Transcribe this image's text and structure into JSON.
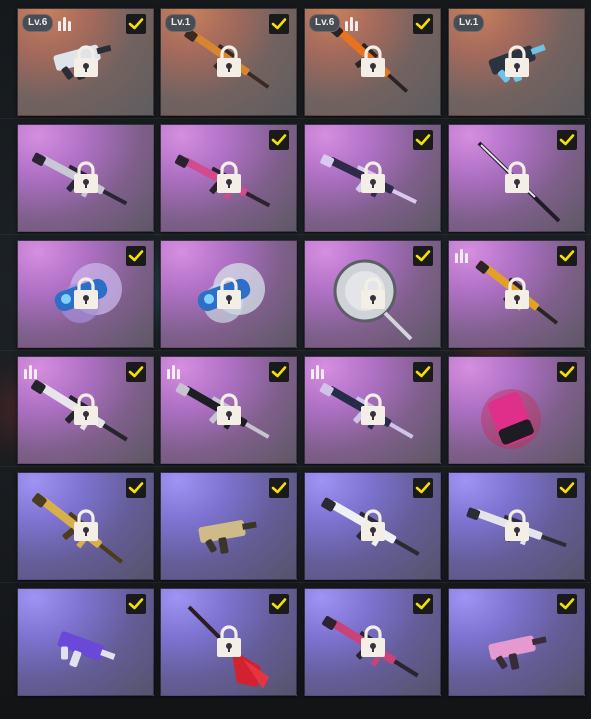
{
  "colors": {
    "check_mark": "#f5e100",
    "check_bg": "#1a1a1d",
    "badge_bg": "#4a4c53",
    "lock": "#f4efe6"
  },
  "items": [
    {
      "rarity": "orange",
      "level": "Lv.6",
      "ammo": true,
      "checked": true,
      "locked": true,
      "icon": "smg-white-icon"
    },
    {
      "rarity": "orange",
      "level": "Lv.1",
      "ammo": false,
      "checked": true,
      "locked": true,
      "icon": "rifle-orange-icon"
    },
    {
      "rarity": "orange",
      "level": "Lv.6",
      "ammo": true,
      "checked": true,
      "locked": true,
      "icon": "rifle-fire-icon"
    },
    {
      "rarity": "orange",
      "level": "Lv.1",
      "ammo": false,
      "checked": false,
      "locked": true,
      "icon": "smg-dark-icon"
    },
    {
      "rarity": "pink",
      "level": "",
      "ammo": false,
      "checked": false,
      "locked": true,
      "icon": "assault-rifle-icon"
    },
    {
      "rarity": "pink",
      "level": "",
      "ammo": false,
      "checked": true,
      "locked": true,
      "icon": "assault-rifle-pink-icon"
    },
    {
      "rarity": "pink",
      "level": "",
      "ammo": false,
      "checked": true,
      "locked": true,
      "icon": "assault-rifle-dark-icon"
    },
    {
      "rarity": "pink",
      "level": "",
      "ammo": false,
      "checked": true,
      "locked": true,
      "icon": "katana-icon"
    },
    {
      "rarity": "pink",
      "level": "",
      "ammo": false,
      "checked": true,
      "locked": true,
      "icon": "smoke-grenade-blue-icon"
    },
    {
      "rarity": "pink",
      "level": "",
      "ammo": false,
      "checked": false,
      "locked": true,
      "icon": "smoke-grenade-white-icon"
    },
    {
      "rarity": "pink",
      "level": "",
      "ammo": false,
      "checked": true,
      "locked": true,
      "icon": "frying-pan-icon"
    },
    {
      "rarity": "pink",
      "level": "",
      "ammo": true,
      "checked": true,
      "locked": true,
      "icon": "rifle-gold-icon"
    },
    {
      "rarity": "pink",
      "level": "",
      "ammo": true,
      "checked": true,
      "locked": true,
      "icon": "dmr-white-icon"
    },
    {
      "rarity": "pink",
      "level": "",
      "ammo": true,
      "checked": true,
      "locked": true,
      "icon": "assault-rifle-black-icon"
    },
    {
      "rarity": "pink",
      "level": "",
      "ammo": true,
      "checked": true,
      "locked": true,
      "icon": "assault-rifle-navy-icon"
    },
    {
      "rarity": "pink",
      "level": "",
      "ammo": false,
      "checked": true,
      "locked": false,
      "icon": "pink-grenade-icon"
    },
    {
      "rarity": "purple",
      "level": "",
      "ammo": false,
      "checked": true,
      "locked": true,
      "icon": "gold-rifle-icon"
    },
    {
      "rarity": "purple",
      "level": "",
      "ammo": false,
      "checked": true,
      "locked": false,
      "icon": "gold-smg-icon"
    },
    {
      "rarity": "purple",
      "level": "",
      "ammo": false,
      "checked": true,
      "locked": true,
      "icon": "white-rifle-icon"
    },
    {
      "rarity": "purple",
      "level": "",
      "ammo": false,
      "checked": true,
      "locked": true,
      "icon": "silver-rifle-icon"
    },
    {
      "rarity": "purple",
      "level": "",
      "ammo": false,
      "checked": true,
      "locked": false,
      "icon": "galaxy-smg-icon"
    },
    {
      "rarity": "purple",
      "level": "",
      "ammo": false,
      "checked": true,
      "locked": true,
      "icon": "guitar-icon"
    },
    {
      "rarity": "purple",
      "level": "",
      "ammo": false,
      "checked": true,
      "locked": true,
      "icon": "pink-rifle-icon"
    },
    {
      "rarity": "purple",
      "level": "",
      "ammo": false,
      "checked": true,
      "locked": false,
      "icon": "pink-smg-icon"
    }
  ]
}
